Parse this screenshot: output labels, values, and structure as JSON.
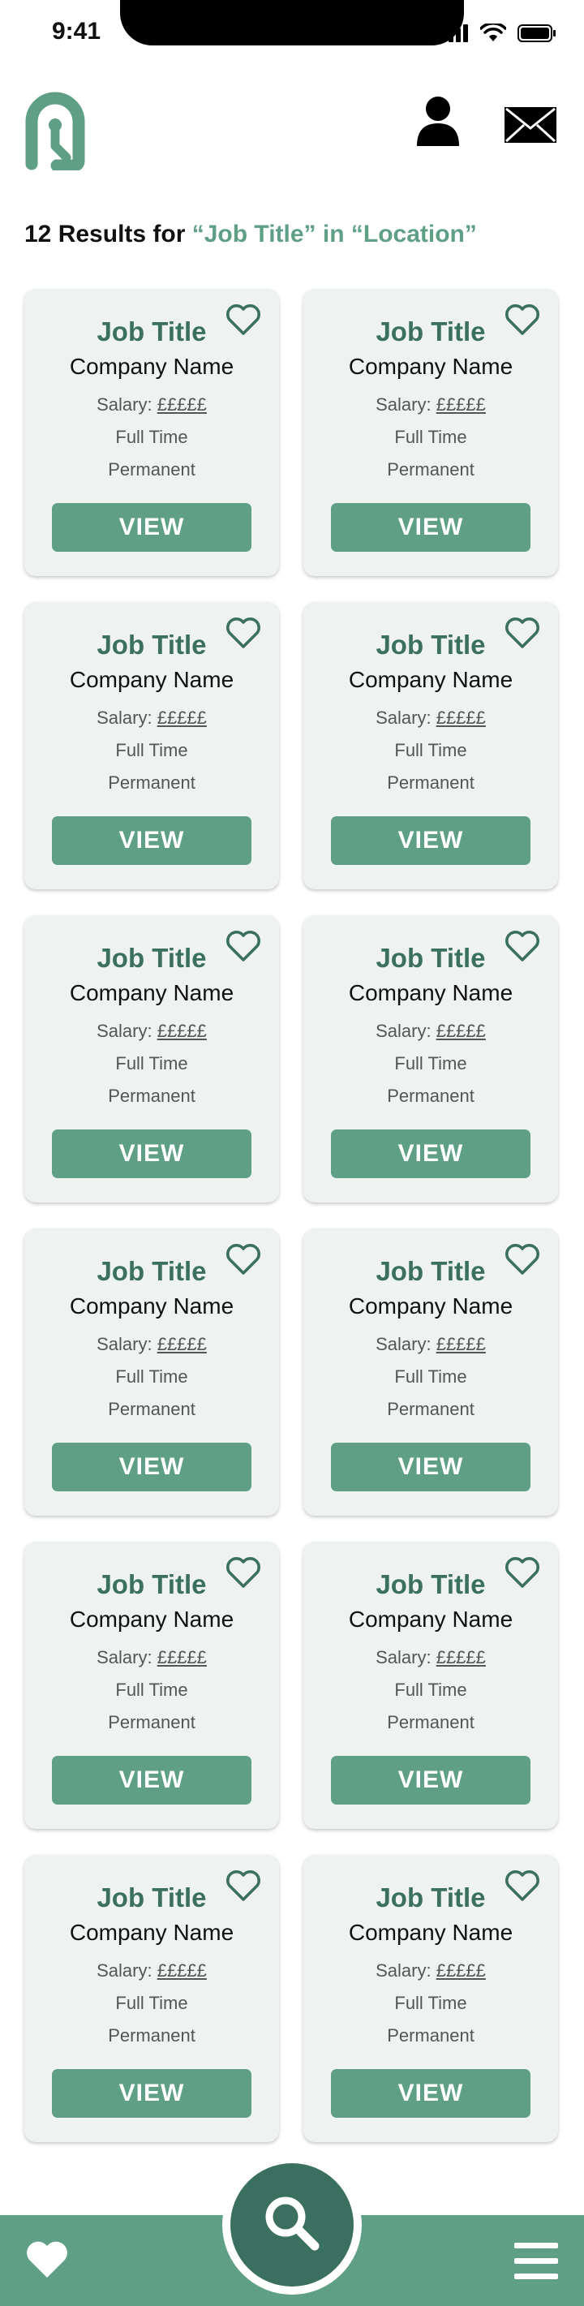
{
  "status_bar": {
    "time": "9:41"
  },
  "results": {
    "count_text": "12 Results for ",
    "query": "“Job Title”",
    "in_text": " in ",
    "location": "“Location”"
  },
  "jobs": [
    {
      "title": "Job Title",
      "company": "Company Name",
      "salary_label": "Salary: ",
      "salary_value": "£££££",
      "type": "Full Time",
      "term": "Permanent",
      "cta": "VIEW"
    },
    {
      "title": "Job Title",
      "company": "Company Name",
      "salary_label": "Salary: ",
      "salary_value": "£££££",
      "type": "Full Time",
      "term": "Permanent",
      "cta": "VIEW"
    },
    {
      "title": "Job Title",
      "company": "Company Name",
      "salary_label": "Salary: ",
      "salary_value": "£££££",
      "type": "Full Time",
      "term": "Permanent",
      "cta": "VIEW"
    },
    {
      "title": "Job Title",
      "company": "Company Name",
      "salary_label": "Salary: ",
      "salary_value": "£££££",
      "type": "Full Time",
      "term": "Permanent",
      "cta": "VIEW"
    },
    {
      "title": "Job Title",
      "company": "Company Name",
      "salary_label": "Salary: ",
      "salary_value": "£££££",
      "type": "Full Time",
      "term": "Permanent",
      "cta": "VIEW"
    },
    {
      "title": "Job Title",
      "company": "Company Name",
      "salary_label": "Salary: ",
      "salary_value": "£££££",
      "type": "Full Time",
      "term": "Permanent",
      "cta": "VIEW"
    },
    {
      "title": "Job Title",
      "company": "Company Name",
      "salary_label": "Salary: ",
      "salary_value": "£££££",
      "type": "Full Time",
      "term": "Permanent",
      "cta": "VIEW"
    },
    {
      "title": "Job Title",
      "company": "Company Name",
      "salary_label": "Salary: ",
      "salary_value": "£££££",
      "type": "Full Time",
      "term": "Permanent",
      "cta": "VIEW"
    },
    {
      "title": "Job Title",
      "company": "Company Name",
      "salary_label": "Salary: ",
      "salary_value": "£££££",
      "type": "Full Time",
      "term": "Permanent",
      "cta": "VIEW"
    },
    {
      "title": "Job Title",
      "company": "Company Name",
      "salary_label": "Salary: ",
      "salary_value": "£££££",
      "type": "Full Time",
      "term": "Permanent",
      "cta": "VIEW"
    },
    {
      "title": "Job Title",
      "company": "Company Name",
      "salary_label": "Salary: ",
      "salary_value": "£££££",
      "type": "Full Time",
      "term": "Permanent",
      "cta": "VIEW"
    },
    {
      "title": "Job Title",
      "company": "Company Name",
      "salary_label": "Salary: ",
      "salary_value": "£££££",
      "type": "Full Time",
      "term": "Permanent",
      "cta": "VIEW"
    }
  ],
  "icons": {
    "logo": "logo-icon",
    "user": "user-icon",
    "mail": "mail-icon",
    "favorite": "heart-outline-icon",
    "nav_favorites": "heart-icon",
    "search": "search-icon",
    "menu": "hamburger-menu-icon"
  },
  "colors": {
    "accent": "#5e9f86",
    "accent_dark": "#3b7060",
    "card_bg": "#eef3f1"
  }
}
